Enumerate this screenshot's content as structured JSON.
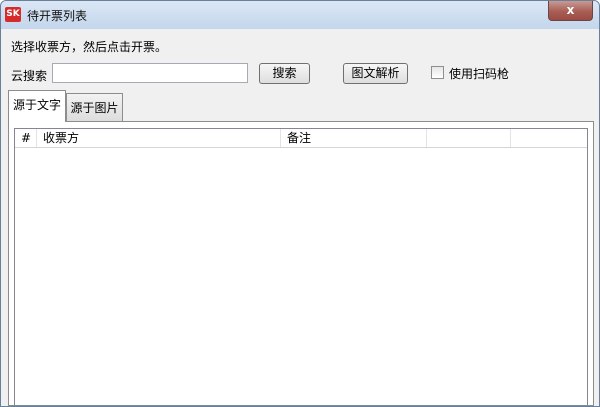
{
  "window": {
    "icon_text": "SK",
    "title": "待开票列表",
    "close_label": "x"
  },
  "form": {
    "instruction": "选择收票方，然后点击开票。",
    "search_label": "云搜索",
    "search_value": "",
    "search_button": "搜索",
    "parse_button": "图文解析",
    "scanner_label": "使用扫码枪",
    "scanner_checked": false
  },
  "tabs": [
    {
      "label": "源于文字",
      "active": true
    },
    {
      "label": "源于图片",
      "active": false
    }
  ],
  "table": {
    "columns": [
      "#",
      "收票方",
      "备注",
      "",
      ""
    ],
    "rows": []
  }
}
